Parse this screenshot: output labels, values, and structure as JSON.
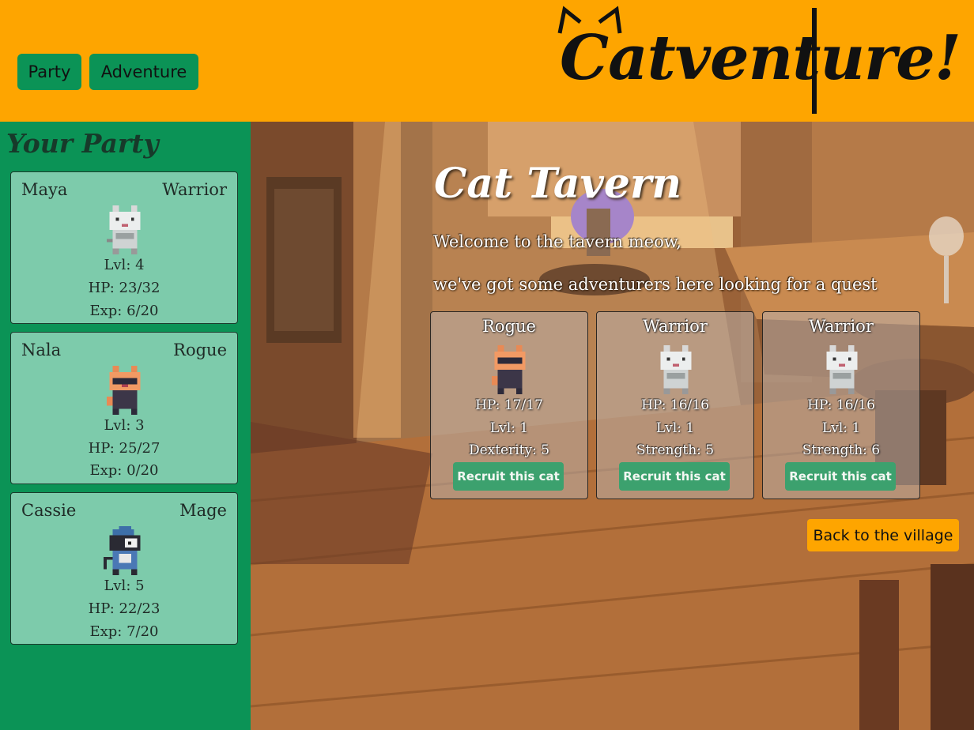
{
  "header": {
    "nav": [
      {
        "label": "Party"
      },
      {
        "label": "Adventure"
      }
    ],
    "logo_text": "Catventure!",
    "logo_color": "#111111",
    "background": "#fea500"
  },
  "sidebar": {
    "title": "Your Party",
    "members": [
      {
        "name": "Maya",
        "class": "Warrior",
        "level": "Lvl: 4",
        "hp": "HP: 23/32",
        "exp": "Exp: 6/20",
        "sprite": "white-cat"
      },
      {
        "name": "Nala",
        "class": "Rogue",
        "level": "Lvl: 3",
        "hp": "HP: 25/27",
        "exp": "Exp: 0/20",
        "sprite": "orange-cat"
      },
      {
        "name": "Cassie",
        "class": "Mage",
        "level": "Lvl: 5",
        "hp": "HP: 22/23",
        "exp": "Exp: 7/20",
        "sprite": "tuxedo-cat-wizard"
      }
    ]
  },
  "tavern": {
    "title": "Cat Tavern",
    "lines": [
      "Welcome to the tavern meow,",
      "we've got some adventurers here looking for a quest"
    ],
    "recruits": [
      {
        "class": "Rogue",
        "hp": "HP: 17/17",
        "level": "Lvl: 1",
        "stat": "Dexterity: 5",
        "button": "Recruit this cat",
        "sprite": "orange-cat"
      },
      {
        "class": "Warrior",
        "hp": "HP: 16/16",
        "level": "Lvl: 1",
        "stat": "Strength: 5",
        "button": "Recruit this cat",
        "sprite": "white-cat"
      },
      {
        "class": "Warrior",
        "hp": "HP: 16/16",
        "level": "Lvl: 1",
        "stat": "Strength: 6",
        "button": "Recruit this cat",
        "sprite": "white-cat"
      }
    ],
    "back_button": "Back to the village"
  },
  "colors": {
    "accent_orange": "#fea500",
    "sidebar_green": "#0b9356",
    "card_green": "#7dcbab",
    "recruit_button": "#3ca16e"
  }
}
